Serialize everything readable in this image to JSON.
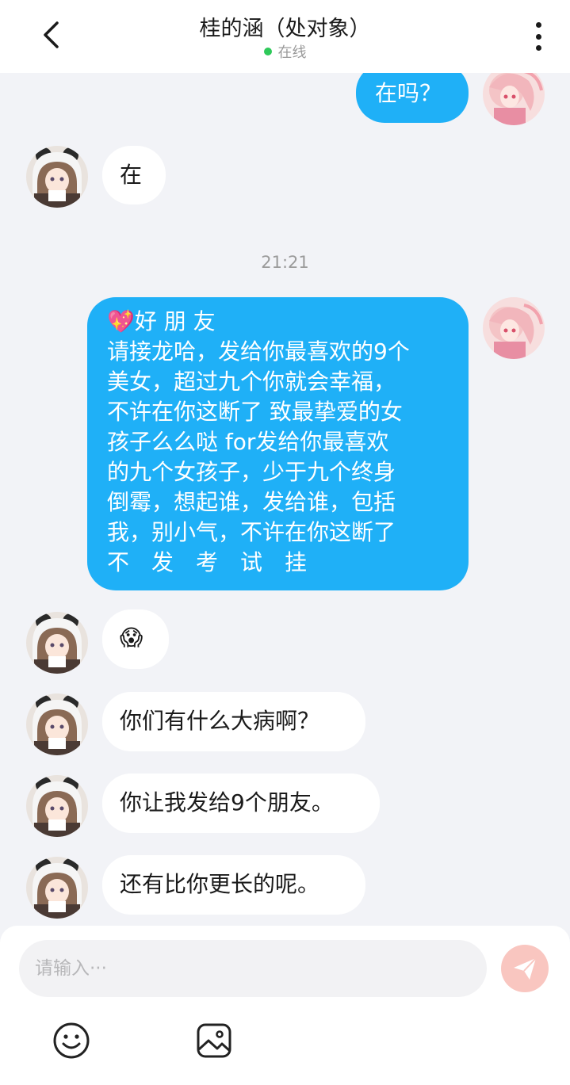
{
  "header": {
    "title": "桂的涵（处对象）",
    "status": "在线",
    "back_icon": "chevron-left-icon",
    "more_icon": "more-vertical-icon",
    "status_color": "#2fc95a"
  },
  "chat": {
    "messages": [
      {
        "side": "out",
        "text": "在吗？"
      },
      {
        "side": "in",
        "text": "在"
      },
      {
        "side": "time",
        "text": "21:21"
      },
      {
        "side": "out",
        "lines": [
          "💖好 朋 友",
          "请接龙哈，发给你最喜欢的9个",
          "美女，超过九个你就会幸福，",
          "不许在你这断了 致最挚爱的女",
          "孩子么么哒 for发给你最喜欢",
          "的九个女孩子，少于九个终身",
          "倒霉，想起谁，发给谁，包括",
          "我，别小气，不许在你这断了",
          "不　发　考　试　挂"
        ]
      },
      {
        "side": "in",
        "text": "😱"
      },
      {
        "side": "in",
        "text": "你们有什么大病啊？"
      },
      {
        "side": "in",
        "text": "你让我发给9个朋友。"
      },
      {
        "side": "in",
        "text": "还有比你更长的呢。"
      }
    ]
  },
  "composer": {
    "placeholder": "请输入···",
    "send_icon": "send-icon",
    "emoji_icon": "smiley-icon",
    "image_icon": "image-icon",
    "send_color": "#f9c6c0"
  },
  "colors": {
    "outgoing_bubble": "#1fb0f7",
    "incoming_bubble": "#ffffff",
    "background": "#f2f3f7"
  }
}
